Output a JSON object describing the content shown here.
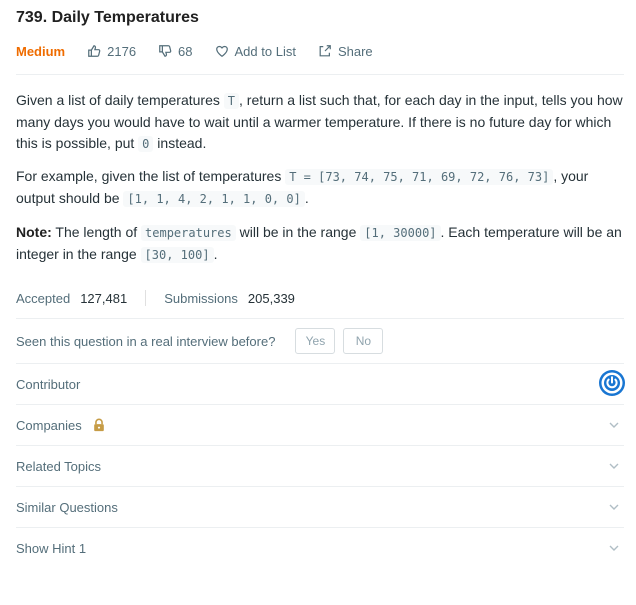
{
  "problem": {
    "title": "739. Daily Temperatures",
    "difficulty": "Medium",
    "likes": "2176",
    "dislikes": "68",
    "add_to_list": "Add to List",
    "share": "Share"
  },
  "description": {
    "p1_a": "Given a list of daily temperatures ",
    "p1_code1": "T",
    "p1_b": ", return a list such that, for each day in the input, tells you how many days you would have to wait until a warmer temperature. If there is no future day for which this is possible, put ",
    "p1_code2": "0",
    "p1_c": " instead.",
    "p2_a": "For example, given the list of temperatures ",
    "p2_code1": "T = [73, 74, 75, 71, 69, 72, 76, 73]",
    "p2_b": ", your output should be ",
    "p2_code2": "[1, 1, 4, 2, 1, 1, 0, 0]",
    "p2_c": ".",
    "p3_note": "Note:",
    "p3_a": " The length of ",
    "p3_code1": "temperatures",
    "p3_b": " will be in the range ",
    "p3_code2": "[1, 30000]",
    "p3_c": ". Each temperature will be an integer in the range ",
    "p3_code3": "[30, 100]",
    "p3_d": "."
  },
  "stats": {
    "accepted_label": "Accepted",
    "accepted_value": "127,481",
    "submissions_label": "Submissions",
    "submissions_value": "205,339"
  },
  "interview": {
    "question": "Seen this question in a real interview before?",
    "yes": "Yes",
    "no": "No"
  },
  "sections": {
    "contributor": "Contributor",
    "companies": "Companies",
    "related_topics": "Related Topics",
    "similar_questions": "Similar Questions",
    "show_hint": "Show Hint 1"
  },
  "colors": {
    "difficulty": "#ef6c00",
    "contributor_icon": "#1976d2",
    "lock_icon": "#c69c46"
  },
  "icons": {
    "likes": "thumbs-up-icon",
    "dislikes": "thumbs-down-icon",
    "add_to_list": "heart-icon",
    "share": "share-icon",
    "contributor": "power-icon",
    "companies": "lock-icon",
    "expand": "chevron-down-icon"
  }
}
